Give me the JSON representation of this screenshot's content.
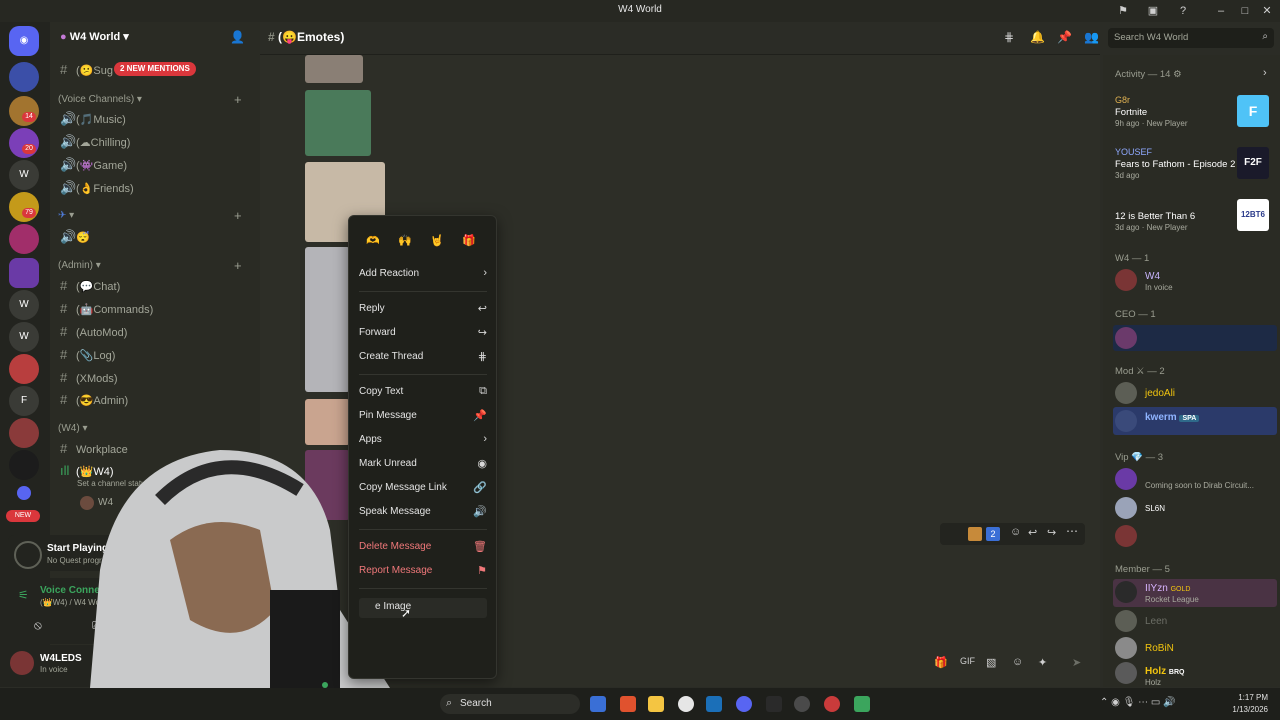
{
  "window": {
    "title": "W4 World"
  },
  "server": {
    "name": "W4 World",
    "mentions_pill": "2 NEW MENTIONS"
  },
  "channels": {
    "top_channel": "(😕Sug",
    "voice_category": "(Voice Channels)",
    "voice": [
      "(🎵Music)",
      "(☁Chilling)",
      "(👾Game)",
      "(👌Friends)"
    ],
    "unnamed_category": "",
    "unnamed_voice": "😴",
    "admin_category": "(Admin)",
    "admin": [
      "(💬Chat)",
      "(🤖Commands)",
      "(AutoMod)",
      "(📎Log)",
      "(XMods)",
      "(😎Admin)"
    ],
    "w4_category": "(W4)",
    "workplace": "Workplace",
    "w4_voice": "(👑W4)",
    "status_prompt": "Set a channel status",
    "voice_member": "W4",
    "new_badge": "NEW"
  },
  "quest": {
    "title": "Start Playing!",
    "sub": "No Quest progress yet"
  },
  "voice_conn": {
    "label": "Voice Connected",
    "sub": "(👑W4) / W4 World"
  },
  "user": {
    "name": "W4LEDS",
    "status": "In voice"
  },
  "header": {
    "channel": "(😛Emotes)",
    "search_placeholder": "Search W4 World"
  },
  "context_menu": {
    "reactions": [
      "🫶",
      "🙌",
      "🤘",
      "🎁"
    ],
    "items": [
      {
        "label": "Add Reaction",
        "icon": "›"
      },
      {
        "label": "Reply",
        "icon": "↩"
      },
      {
        "label": "Forward",
        "icon": "↪"
      },
      {
        "label": "Create Thread",
        "icon": "⋕"
      },
      {
        "label": "Copy Text",
        "icon": "⧉"
      },
      {
        "label": "Pin Message",
        "icon": "📌"
      },
      {
        "label": "Apps",
        "icon": "›"
      },
      {
        "label": "Mark Unread",
        "icon": "◉"
      },
      {
        "label": "Copy Message Link",
        "icon": "🔗"
      },
      {
        "label": "Speak Message",
        "icon": "🔊"
      },
      {
        "label": "Delete Message",
        "icon": "🗑"
      },
      {
        "label": "Report Message",
        "icon": "⚑"
      }
    ],
    "partial_item": "e Image"
  },
  "message_toolbar": {
    "count": "2"
  },
  "members": {
    "activity": "Activity — 14",
    "activities": [
      {
        "name": "G8r",
        "game": "Fortnite",
        "time": "9h ago",
        "tag": "New Player",
        "art": "F"
      },
      {
        "name": "YOUSEF",
        "game": "Fears to Fathom - Episode 2",
        "time": "3d ago",
        "tag": "",
        "art": "F2F"
      },
      {
        "name": "",
        "game": "12 is Better Than 6",
        "time": "3d ago",
        "tag": "New Player",
        "art": "12BT6"
      }
    ],
    "w4_cat": "W4 — 1",
    "w4_member": {
      "name": "W4",
      "sub": "In voice"
    },
    "ceo_cat": "CEO — 1",
    "mod_cat": "Mod ⚔ — 2",
    "mods": [
      {
        "name": "jedoAli",
        "sub": ""
      },
      {
        "name": "kwerm",
        "sub": "SPA"
      }
    ],
    "vip_cat": "Vip 💎 — 3",
    "vips": [
      {
        "name": "",
        "sub": "Coming soon to Dirab Circuit..."
      },
      {
        "name": "",
        "sub": "SL6N"
      },
      {
        "name": "",
        "sub": ""
      }
    ],
    "member_cat": "Member — 5",
    "regulars": [
      {
        "name": "IIYzn",
        "tag": "GOLD",
        "sub": "Rocket League"
      },
      {
        "name": "Leen",
        "tag": "",
        "sub": ""
      },
      {
        "name": "RoBiN",
        "tag": "",
        "sub": ""
      },
      {
        "name": "Holz",
        "tag": "BRQ",
        "sub": "Holz"
      }
    ]
  },
  "taskbar": {
    "search": "Search",
    "time": "1:17 PM",
    "date": "1/13/2026"
  }
}
